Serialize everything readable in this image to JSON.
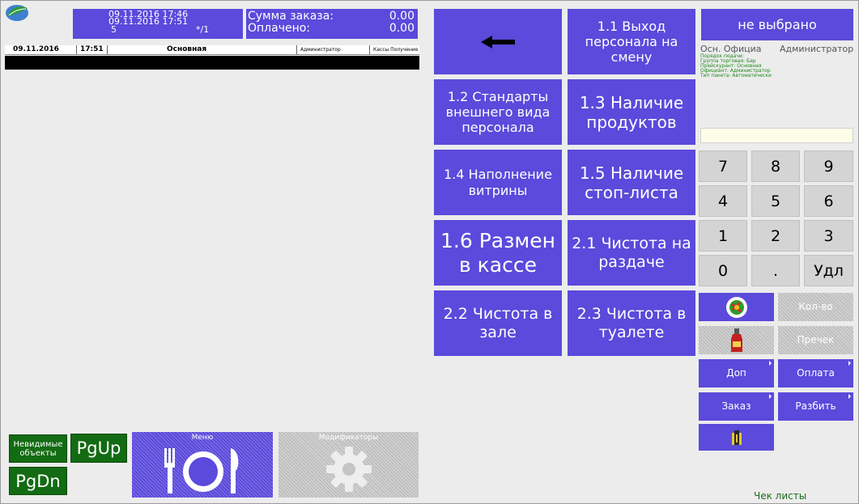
{
  "header": {
    "datetime_line1": "09.11.2016 17:46",
    "datetime_line2": "09.11.2016 17:51",
    "small_num": "5",
    "star": "*/1",
    "sum_label": "Сумма заказа:",
    "sum_value": "0.00",
    "paid_label": "Оплачено:",
    "paid_value": "0.00"
  },
  "order_bar": {
    "date": "09.11.2016",
    "time": "17:51",
    "section": "Основная",
    "user": "Администратор",
    "cashier": "Кассы Получение"
  },
  "left_buttons": {
    "invisible": "Невидимые объекты",
    "pgup": "PgUp",
    "pgdn": "PgDn",
    "menu": "Меню",
    "modifiers": "Модификаторы"
  },
  "tiles": {
    "t11": "1.1 Выход персонала на смену",
    "t12": "1.2 Стандарты внешнего вида персонала",
    "t13": "1.3 Наличие продуктов",
    "t14": "1.4 Наполнение витрины",
    "t15": "1.5 Наличие стоп-листа",
    "t16": "1.6 Размен в кассе",
    "t21": "2.1 Чистота на раздаче",
    "t22": "2.2 Чистота в зале",
    "t23": "2.3 Чистота в туалете"
  },
  "info": {
    "not_selected": "не выбрано",
    "waiter_short": "Осн. Официа",
    "admin": "Администратор",
    "line1": "Порядок подачи:",
    "line2": "Группа торговая: Бар",
    "line3": "Прейскурант: Основная",
    "line4": "Официант: Администратор",
    "line5": "Тип пакета: Автоматически"
  },
  "keypad": [
    "7",
    "8",
    "9",
    "4",
    "5",
    "6",
    "1",
    "2",
    "3",
    "0",
    ".",
    "Удл"
  ],
  "actions": {
    "qty": "Кол-во",
    "precheck": "Пречек",
    "dop": "Доп",
    "payment": "Оплата",
    "order": "Заказ",
    "split": "Разбить",
    "check_lists": "Чек листы"
  },
  "colors": {
    "accent": "#5b4adb",
    "green": "#136b13",
    "info_green": "#1b8a1b"
  }
}
